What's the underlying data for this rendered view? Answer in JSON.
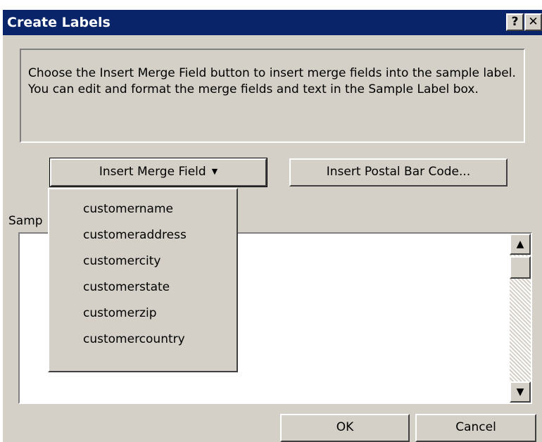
{
  "window": {
    "title": "Create Labels",
    "help_label": "?",
    "close_label": "✕"
  },
  "instructions": "Choose the Insert Merge Field button to insert merge fields into the sample label.  You can edit and format the merge fields and text in the Sample Label box.",
  "buttons": {
    "insert_merge_field": "Insert Merge Field",
    "insert_postal_bar_code": "Insert Postal Bar Code...",
    "ok": "OK",
    "cancel": "Cancel"
  },
  "sample_label": {
    "label_visible": "Samp",
    "value": ""
  },
  "merge_fields": [
    "customername",
    "customeraddress",
    "customercity",
    "customerstate",
    "customerzip",
    "customercountry"
  ]
}
